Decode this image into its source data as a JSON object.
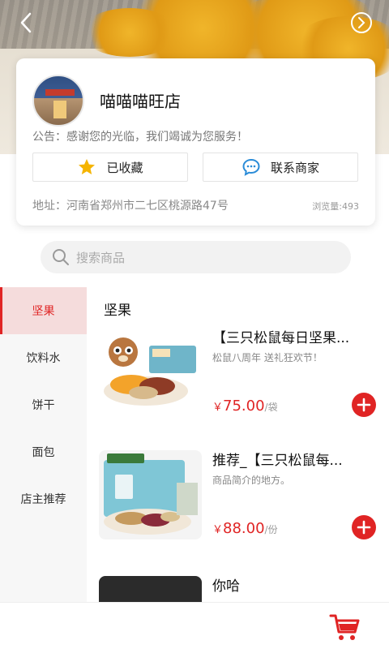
{
  "header": {
    "back_icon": "chevron-left-icon",
    "info_icon": "circle-arrow-icon"
  },
  "shop": {
    "name": "喵喵喵旺店",
    "notice": "公告：感谢您的光临，我们竭诚为您服务！",
    "favorite_label": "已收藏",
    "contact_label": "联系商家",
    "address": "地址：河南省郑州市二七区桃源路47号",
    "views": "浏览量:493"
  },
  "search": {
    "placeholder": "搜索商品"
  },
  "categories": [
    {
      "label": "坚果",
      "active": true
    },
    {
      "label": "饮料水",
      "active": false
    },
    {
      "label": "饼干",
      "active": false
    },
    {
      "label": "面包",
      "active": false
    },
    {
      "label": "店主推荐",
      "active": false
    }
  ],
  "section_title": "坚果",
  "products": [
    {
      "name": "【三只松鼠每日坚果...",
      "desc": "松鼠八周年 送礼狂欢节！",
      "currency": "￥",
      "price": "75.00",
      "unit": "/袋"
    },
    {
      "name": "推荐_【三只松鼠每...",
      "desc": "商品简介的地方。",
      "currency": "￥",
      "price": "88.00",
      "unit": "/份"
    },
    {
      "name": "你哈",
      "desc": "",
      "currency": "",
      "price": "",
      "unit": ""
    }
  ],
  "colors": {
    "accent": "#e02424",
    "star": "#f5b400",
    "chat": "#2a8cd8"
  }
}
